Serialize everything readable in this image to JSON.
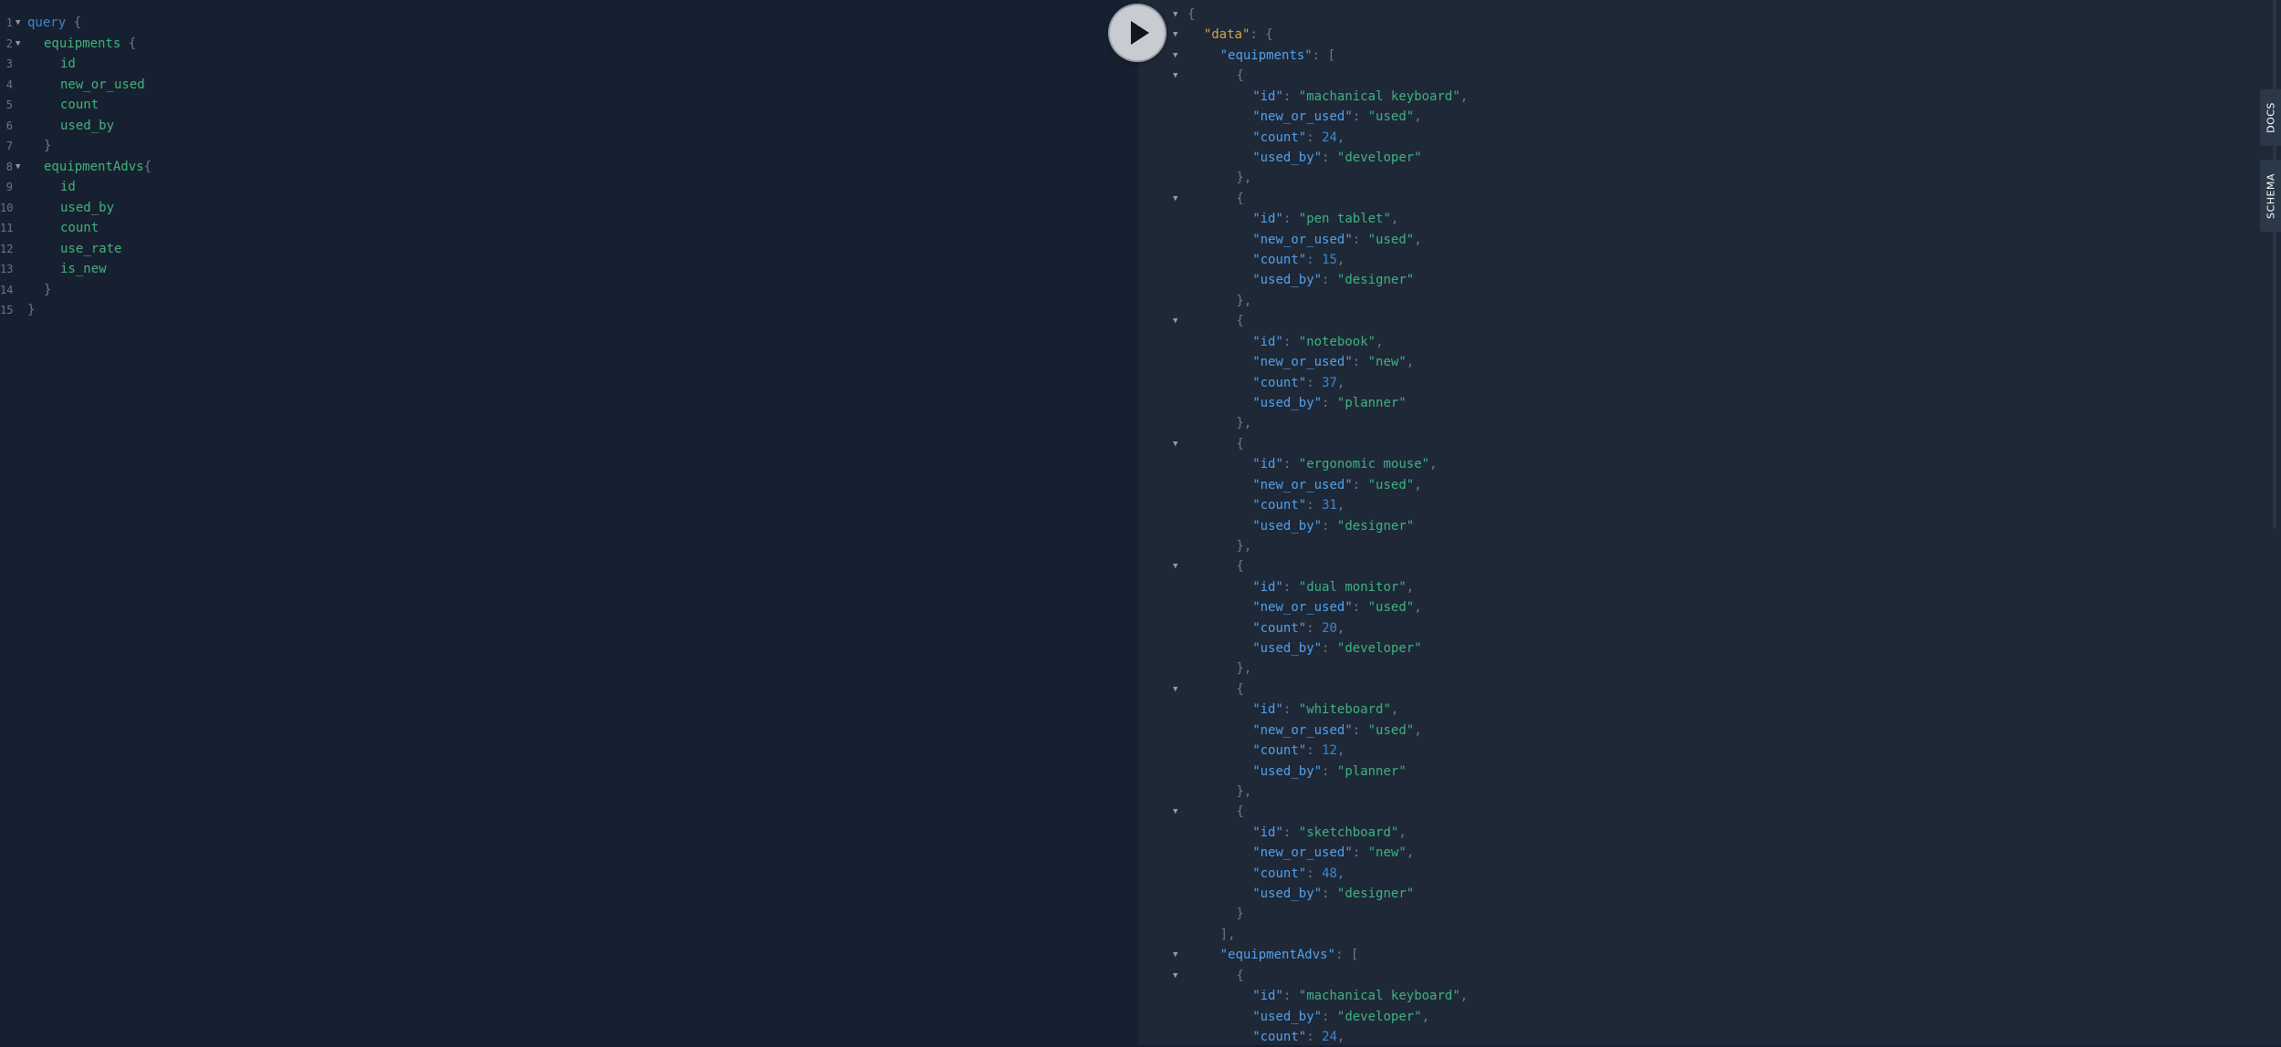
{
  "query": {
    "lines": [
      {
        "n": "1",
        "fold": true,
        "indent": 0,
        "parts": [
          {
            "t": "query",
            "c": "kw"
          },
          {
            "t": " {",
            "c": "punc"
          }
        ]
      },
      {
        "n": "2",
        "fold": true,
        "indent": 1,
        "parts": [
          {
            "t": "equipments",
            "c": "fld"
          },
          {
            "t": " {",
            "c": "punc"
          }
        ]
      },
      {
        "n": "3",
        "fold": false,
        "indent": 2,
        "parts": [
          {
            "t": "id",
            "c": "fld"
          }
        ]
      },
      {
        "n": "4",
        "fold": false,
        "indent": 2,
        "parts": [
          {
            "t": "new_or_used",
            "c": "fld"
          }
        ]
      },
      {
        "n": "5",
        "fold": false,
        "indent": 2,
        "parts": [
          {
            "t": "count",
            "c": "fld"
          }
        ]
      },
      {
        "n": "6",
        "fold": false,
        "indent": 2,
        "parts": [
          {
            "t": "used_by",
            "c": "fld"
          }
        ]
      },
      {
        "n": "7",
        "fold": false,
        "indent": 1,
        "parts": [
          {
            "t": "}",
            "c": "punc"
          }
        ]
      },
      {
        "n": "8",
        "fold": true,
        "indent": 1,
        "parts": [
          {
            "t": "equipmentAdvs",
            "c": "fld"
          },
          {
            "t": "{",
            "c": "punc"
          }
        ]
      },
      {
        "n": "9",
        "fold": false,
        "indent": 2,
        "parts": [
          {
            "t": "id",
            "c": "fld"
          }
        ]
      },
      {
        "n": "10",
        "fold": false,
        "indent": 2,
        "parts": [
          {
            "t": "used_by",
            "c": "fld"
          }
        ]
      },
      {
        "n": "11",
        "fold": false,
        "indent": 2,
        "parts": [
          {
            "t": "count",
            "c": "fld"
          }
        ]
      },
      {
        "n": "12",
        "fold": false,
        "indent": 2,
        "parts": [
          {
            "t": "use_rate",
            "c": "fld"
          }
        ]
      },
      {
        "n": "13",
        "fold": false,
        "indent": 2,
        "parts": [
          {
            "t": "is_new",
            "c": "fld"
          }
        ]
      },
      {
        "n": "14",
        "fold": false,
        "indent": 1,
        "parts": [
          {
            "t": "}",
            "c": "punc"
          }
        ]
      },
      {
        "n": "15",
        "fold": false,
        "indent": 0,
        "parts": [
          {
            "t": "}",
            "c": "punc"
          }
        ]
      }
    ]
  },
  "result": {
    "lines": [
      {
        "fold": true,
        "indent": 0,
        "parts": [
          {
            "t": "{",
            "c": "punc"
          }
        ]
      },
      {
        "fold": true,
        "indent": 1,
        "parts": [
          {
            "t": "\"data\"",
            "c": "datakey"
          },
          {
            "t": ": {",
            "c": "punc"
          }
        ]
      },
      {
        "fold": true,
        "indent": 2,
        "parts": [
          {
            "t": "\"equipments\"",
            "c": "key"
          },
          {
            "t": ": [",
            "c": "punc"
          }
        ]
      },
      {
        "fold": true,
        "indent": 3,
        "parts": [
          {
            "t": "{",
            "c": "punc"
          }
        ]
      },
      {
        "fold": false,
        "indent": 4,
        "parts": [
          {
            "t": "\"id\"",
            "c": "key"
          },
          {
            "t": ": ",
            "c": "punc"
          },
          {
            "t": "\"machanical keyboard\"",
            "c": "str"
          },
          {
            "t": ",",
            "c": "punc"
          }
        ]
      },
      {
        "fold": false,
        "indent": 4,
        "parts": [
          {
            "t": "\"new_or_used\"",
            "c": "key"
          },
          {
            "t": ": ",
            "c": "punc"
          },
          {
            "t": "\"used\"",
            "c": "str"
          },
          {
            "t": ",",
            "c": "punc"
          }
        ]
      },
      {
        "fold": false,
        "indent": 4,
        "parts": [
          {
            "t": "\"count\"",
            "c": "key"
          },
          {
            "t": ": ",
            "c": "punc"
          },
          {
            "t": "24",
            "c": "num"
          },
          {
            "t": ",",
            "c": "punc"
          }
        ]
      },
      {
        "fold": false,
        "indent": 4,
        "parts": [
          {
            "t": "\"used_by\"",
            "c": "key"
          },
          {
            "t": ": ",
            "c": "punc"
          },
          {
            "t": "\"developer\"",
            "c": "str"
          }
        ]
      },
      {
        "fold": false,
        "indent": 3,
        "parts": [
          {
            "t": "},",
            "c": "punc"
          }
        ]
      },
      {
        "fold": true,
        "indent": 3,
        "parts": [
          {
            "t": "{",
            "c": "punc"
          }
        ]
      },
      {
        "fold": false,
        "indent": 4,
        "parts": [
          {
            "t": "\"id\"",
            "c": "key"
          },
          {
            "t": ": ",
            "c": "punc"
          },
          {
            "t": "\"pen tablet\"",
            "c": "str"
          },
          {
            "t": ",",
            "c": "punc"
          }
        ]
      },
      {
        "fold": false,
        "indent": 4,
        "parts": [
          {
            "t": "\"new_or_used\"",
            "c": "key"
          },
          {
            "t": ": ",
            "c": "punc"
          },
          {
            "t": "\"used\"",
            "c": "str"
          },
          {
            "t": ",",
            "c": "punc"
          }
        ]
      },
      {
        "fold": false,
        "indent": 4,
        "parts": [
          {
            "t": "\"count\"",
            "c": "key"
          },
          {
            "t": ": ",
            "c": "punc"
          },
          {
            "t": "15",
            "c": "num"
          },
          {
            "t": ",",
            "c": "punc"
          }
        ]
      },
      {
        "fold": false,
        "indent": 4,
        "parts": [
          {
            "t": "\"used_by\"",
            "c": "key"
          },
          {
            "t": ": ",
            "c": "punc"
          },
          {
            "t": "\"designer\"",
            "c": "str"
          }
        ]
      },
      {
        "fold": false,
        "indent": 3,
        "parts": [
          {
            "t": "},",
            "c": "punc"
          }
        ]
      },
      {
        "fold": true,
        "indent": 3,
        "parts": [
          {
            "t": "{",
            "c": "punc"
          }
        ]
      },
      {
        "fold": false,
        "indent": 4,
        "parts": [
          {
            "t": "\"id\"",
            "c": "key"
          },
          {
            "t": ": ",
            "c": "punc"
          },
          {
            "t": "\"notebook\"",
            "c": "str"
          },
          {
            "t": ",",
            "c": "punc"
          }
        ]
      },
      {
        "fold": false,
        "indent": 4,
        "parts": [
          {
            "t": "\"new_or_used\"",
            "c": "key"
          },
          {
            "t": ": ",
            "c": "punc"
          },
          {
            "t": "\"new\"",
            "c": "str"
          },
          {
            "t": ",",
            "c": "punc"
          }
        ]
      },
      {
        "fold": false,
        "indent": 4,
        "parts": [
          {
            "t": "\"count\"",
            "c": "key"
          },
          {
            "t": ": ",
            "c": "punc"
          },
          {
            "t": "37",
            "c": "num"
          },
          {
            "t": ",",
            "c": "punc"
          }
        ]
      },
      {
        "fold": false,
        "indent": 4,
        "parts": [
          {
            "t": "\"used_by\"",
            "c": "key"
          },
          {
            "t": ": ",
            "c": "punc"
          },
          {
            "t": "\"planner\"",
            "c": "str"
          }
        ]
      },
      {
        "fold": false,
        "indent": 3,
        "parts": [
          {
            "t": "},",
            "c": "punc"
          }
        ]
      },
      {
        "fold": true,
        "indent": 3,
        "parts": [
          {
            "t": "{",
            "c": "punc"
          }
        ]
      },
      {
        "fold": false,
        "indent": 4,
        "parts": [
          {
            "t": "\"id\"",
            "c": "key"
          },
          {
            "t": ": ",
            "c": "punc"
          },
          {
            "t": "\"ergonomic mouse\"",
            "c": "str"
          },
          {
            "t": ",",
            "c": "punc"
          }
        ]
      },
      {
        "fold": false,
        "indent": 4,
        "parts": [
          {
            "t": "\"new_or_used\"",
            "c": "key"
          },
          {
            "t": ": ",
            "c": "punc"
          },
          {
            "t": "\"used\"",
            "c": "str"
          },
          {
            "t": ",",
            "c": "punc"
          }
        ]
      },
      {
        "fold": false,
        "indent": 4,
        "parts": [
          {
            "t": "\"count\"",
            "c": "key"
          },
          {
            "t": ": ",
            "c": "punc"
          },
          {
            "t": "31",
            "c": "num"
          },
          {
            "t": ",",
            "c": "punc"
          }
        ]
      },
      {
        "fold": false,
        "indent": 4,
        "parts": [
          {
            "t": "\"used_by\"",
            "c": "key"
          },
          {
            "t": ": ",
            "c": "punc"
          },
          {
            "t": "\"designer\"",
            "c": "str"
          }
        ]
      },
      {
        "fold": false,
        "indent": 3,
        "parts": [
          {
            "t": "},",
            "c": "punc"
          }
        ]
      },
      {
        "fold": true,
        "indent": 3,
        "parts": [
          {
            "t": "{",
            "c": "punc"
          }
        ]
      },
      {
        "fold": false,
        "indent": 4,
        "parts": [
          {
            "t": "\"id\"",
            "c": "key"
          },
          {
            "t": ": ",
            "c": "punc"
          },
          {
            "t": "\"dual monitor\"",
            "c": "str"
          },
          {
            "t": ",",
            "c": "punc"
          }
        ]
      },
      {
        "fold": false,
        "indent": 4,
        "parts": [
          {
            "t": "\"new_or_used\"",
            "c": "key"
          },
          {
            "t": ": ",
            "c": "punc"
          },
          {
            "t": "\"used\"",
            "c": "str"
          },
          {
            "t": ",",
            "c": "punc"
          }
        ]
      },
      {
        "fold": false,
        "indent": 4,
        "parts": [
          {
            "t": "\"count\"",
            "c": "key"
          },
          {
            "t": ": ",
            "c": "punc"
          },
          {
            "t": "20",
            "c": "num"
          },
          {
            "t": ",",
            "c": "punc"
          }
        ]
      },
      {
        "fold": false,
        "indent": 4,
        "parts": [
          {
            "t": "\"used_by\"",
            "c": "key"
          },
          {
            "t": ": ",
            "c": "punc"
          },
          {
            "t": "\"developer\"",
            "c": "str"
          }
        ]
      },
      {
        "fold": false,
        "indent": 3,
        "parts": [
          {
            "t": "},",
            "c": "punc"
          }
        ]
      },
      {
        "fold": true,
        "indent": 3,
        "parts": [
          {
            "t": "{",
            "c": "punc"
          }
        ]
      },
      {
        "fold": false,
        "indent": 4,
        "parts": [
          {
            "t": "\"id\"",
            "c": "key"
          },
          {
            "t": ": ",
            "c": "punc"
          },
          {
            "t": "\"whiteboard\"",
            "c": "str"
          },
          {
            "t": ",",
            "c": "punc"
          }
        ]
      },
      {
        "fold": false,
        "indent": 4,
        "parts": [
          {
            "t": "\"new_or_used\"",
            "c": "key"
          },
          {
            "t": ": ",
            "c": "punc"
          },
          {
            "t": "\"used\"",
            "c": "str"
          },
          {
            "t": ",",
            "c": "punc"
          }
        ]
      },
      {
        "fold": false,
        "indent": 4,
        "parts": [
          {
            "t": "\"count\"",
            "c": "key"
          },
          {
            "t": ": ",
            "c": "punc"
          },
          {
            "t": "12",
            "c": "num"
          },
          {
            "t": ",",
            "c": "punc"
          }
        ]
      },
      {
        "fold": false,
        "indent": 4,
        "parts": [
          {
            "t": "\"used_by\"",
            "c": "key"
          },
          {
            "t": ": ",
            "c": "punc"
          },
          {
            "t": "\"planner\"",
            "c": "str"
          }
        ]
      },
      {
        "fold": false,
        "indent": 3,
        "parts": [
          {
            "t": "},",
            "c": "punc"
          }
        ]
      },
      {
        "fold": true,
        "indent": 3,
        "parts": [
          {
            "t": "{",
            "c": "punc"
          }
        ]
      },
      {
        "fold": false,
        "indent": 4,
        "parts": [
          {
            "t": "\"id\"",
            "c": "key"
          },
          {
            "t": ": ",
            "c": "punc"
          },
          {
            "t": "\"sketchboard\"",
            "c": "str"
          },
          {
            "t": ",",
            "c": "punc"
          }
        ]
      },
      {
        "fold": false,
        "indent": 4,
        "parts": [
          {
            "t": "\"new_or_used\"",
            "c": "key"
          },
          {
            "t": ": ",
            "c": "punc"
          },
          {
            "t": "\"new\"",
            "c": "str"
          },
          {
            "t": ",",
            "c": "punc"
          }
        ]
      },
      {
        "fold": false,
        "indent": 4,
        "parts": [
          {
            "t": "\"count\"",
            "c": "key"
          },
          {
            "t": ": ",
            "c": "punc"
          },
          {
            "t": "48",
            "c": "num"
          },
          {
            "t": ",",
            "c": "punc"
          }
        ]
      },
      {
        "fold": false,
        "indent": 4,
        "parts": [
          {
            "t": "\"used_by\"",
            "c": "key"
          },
          {
            "t": ": ",
            "c": "punc"
          },
          {
            "t": "\"designer\"",
            "c": "str"
          }
        ]
      },
      {
        "fold": false,
        "indent": 3,
        "parts": [
          {
            "t": "}",
            "c": "punc"
          }
        ]
      },
      {
        "fold": false,
        "indent": 2,
        "parts": [
          {
            "t": "],",
            "c": "punc"
          }
        ]
      },
      {
        "fold": true,
        "indent": 2,
        "parts": [
          {
            "t": "\"equipmentAdvs\"",
            "c": "key"
          },
          {
            "t": ": [",
            "c": "punc"
          }
        ]
      },
      {
        "fold": true,
        "indent": 3,
        "parts": [
          {
            "t": "{",
            "c": "punc"
          }
        ]
      },
      {
        "fold": false,
        "indent": 4,
        "parts": [
          {
            "t": "\"id\"",
            "c": "key"
          },
          {
            "t": ": ",
            "c": "punc"
          },
          {
            "t": "\"machanical keyboard\"",
            "c": "str"
          },
          {
            "t": ",",
            "c": "punc"
          }
        ]
      },
      {
        "fold": false,
        "indent": 4,
        "parts": [
          {
            "t": "\"used_by\"",
            "c": "key"
          },
          {
            "t": ": ",
            "c": "punc"
          },
          {
            "t": "\"developer\"",
            "c": "str"
          },
          {
            "t": ",",
            "c": "punc"
          }
        ]
      },
      {
        "fold": false,
        "indent": 4,
        "parts": [
          {
            "t": "\"count\"",
            "c": "key"
          },
          {
            "t": ": ",
            "c": "punc"
          },
          {
            "t": "24",
            "c": "num"
          },
          {
            "t": ",",
            "c": "punc"
          }
        ]
      }
    ]
  },
  "toolbar": {
    "run_label": "Execute Query"
  },
  "sidetabs": {
    "docs": "DOCS",
    "schema": "SCHEMA"
  },
  "colors": {
    "editor_bg": "#172030",
    "result_bg": "#1e2837",
    "keyword": "#3e86cf",
    "field": "#41b37a",
    "string": "#3fb27f",
    "data_key": "#d3a54d"
  }
}
